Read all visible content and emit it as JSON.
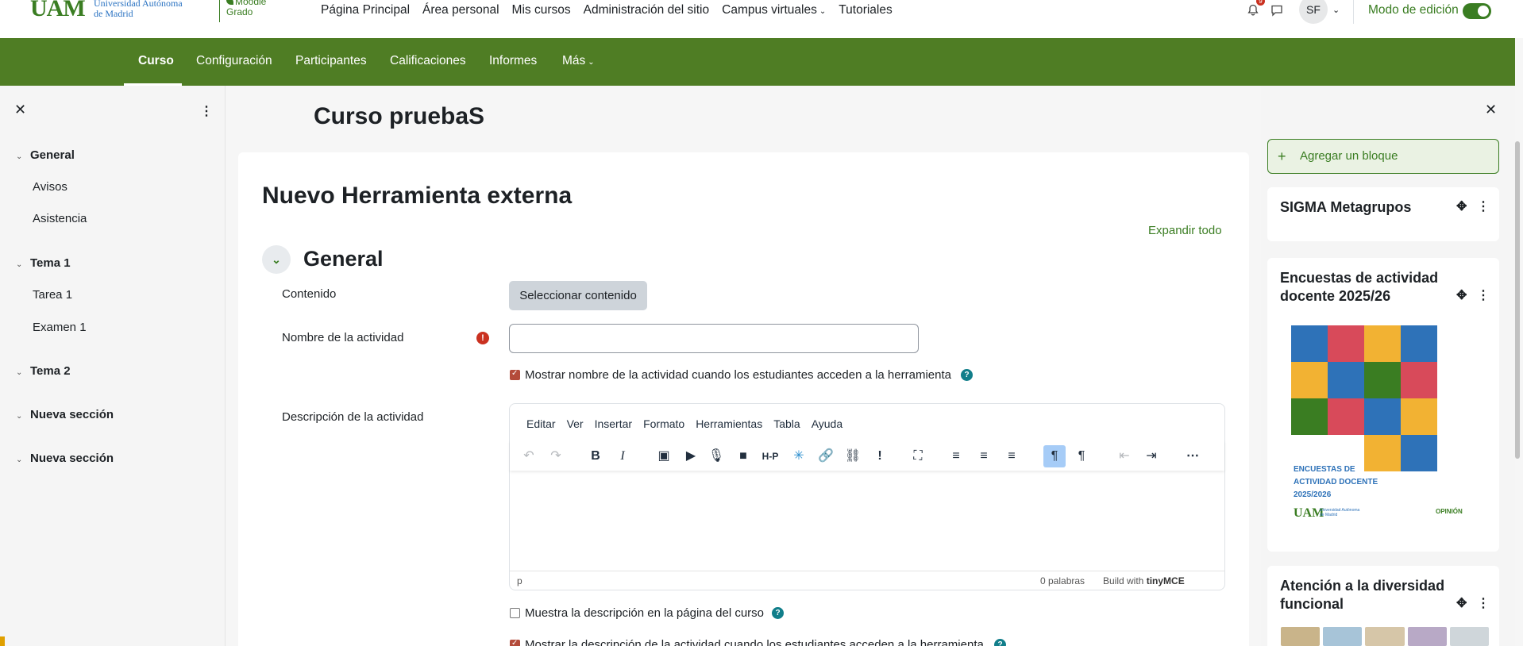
{
  "topbar": {
    "logo_uam": "UAM",
    "logo_line1": "Universidad Autónoma",
    "logo_line2": "de Madrid",
    "logo_moodle1": "Moodle",
    "logo_moodle2": "Grado",
    "nav": [
      "Página Principal",
      "Área personal",
      "Mis cursos",
      "Administración del sitio",
      "Campus virtuales",
      "Tutoriales"
    ],
    "notifications_count": "9",
    "avatar_initials": "SF",
    "edit_mode_label": "Modo de edición",
    "edit_mode_on": true
  },
  "secondary_nav": {
    "tabs": [
      "Curso",
      "Configuración",
      "Participantes",
      "Calificaciones",
      "Informes",
      "Más"
    ],
    "active": "Curso"
  },
  "course_index": {
    "sections": [
      {
        "title": "General",
        "items": [
          "Avisos",
          "Asistencia"
        ]
      },
      {
        "title": "Tema 1",
        "items": [
          "Tarea 1",
          "Examen 1"
        ]
      },
      {
        "title": "Tema 2",
        "items": []
      },
      {
        "title": "Nueva sección",
        "items": []
      },
      {
        "title": "Nueva sección",
        "items": []
      }
    ]
  },
  "main": {
    "course_title": "Curso pruebaS",
    "page_heading": "Nuevo Herramienta externa",
    "expand_all": "Expandir todo",
    "section_heading": "General",
    "content_label": "Contenido",
    "select_content_button": "Seleccionar contenido",
    "activity_name_label": "Nombre de la actividad",
    "activity_name_value": "",
    "show_name_checkbox": "Mostrar nombre de la actividad cuando los estudiantes acceden a la herramienta",
    "description_label": "Descripción de la actividad",
    "show_desc_course_checkbox": "Muestra la descripción en la página del curso",
    "show_desc_tool_checkbox": "Mostrar la descripción de la actividad cuando los estudiantes acceden a la herramienta"
  },
  "editor": {
    "menu": [
      "Editar",
      "Ver",
      "Insertar",
      "Formato",
      "Herramientas",
      "Tabla",
      "Ayuda"
    ],
    "status_path": "p",
    "word_count": "0 palabras",
    "build_with": "Build with",
    "brand": "tinyMCE"
  },
  "blocks": {
    "add_block": "Agregar un bloque",
    "sigma_title": "SIGMA Metagrupos",
    "encuestas_title_1": "Encuestas de actividad",
    "encuestas_title_2": "docente 2025/26",
    "poster_line1": "ENCUESTAS DE",
    "poster_line2": "ACTIVIDAD DOCENTE",
    "poster_line3": "2025/2026",
    "poster_logo": "UAM",
    "poster_sub1": "Universidad Autónoma",
    "poster_sub2": "de Madrid",
    "poster_opinion": "OPINIÓN",
    "diversidad_title_1": "Atención a la diversidad",
    "diversidad_title_2": "funcional"
  },
  "colors": {
    "brand_green": "#4f7d24",
    "accent_green": "#3a7d22",
    "checkbox_on": "#b44b3a",
    "help_icon": "#117e8a"
  }
}
